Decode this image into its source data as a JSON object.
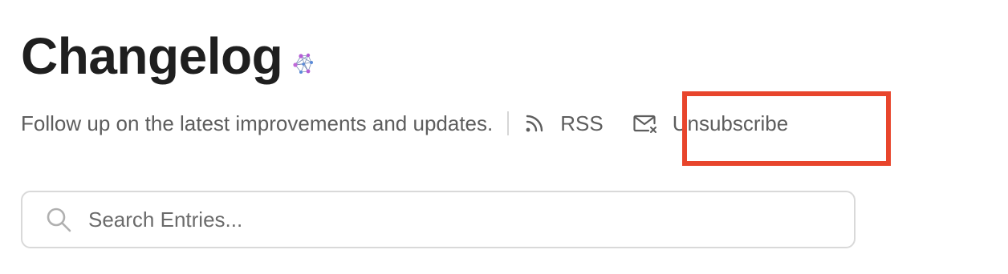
{
  "header": {
    "title": "Changelog",
    "subtitle": "Follow up on the latest improvements and updates."
  },
  "links": {
    "rss_label": "RSS",
    "unsubscribe_label": "Unsubscribe"
  },
  "search": {
    "placeholder": "Search Entries..."
  },
  "icons": {
    "logo": "network-logo-icon",
    "rss": "rss-icon",
    "unsubscribe": "mail-x-icon",
    "search": "search-icon"
  },
  "colors": {
    "title": "#1f1f1f",
    "text": "#5d5d5d",
    "highlight": "#e8452c",
    "border": "#d9d9d9",
    "logo_purple": "#b45cd6",
    "logo_blue": "#5a8bd8"
  }
}
